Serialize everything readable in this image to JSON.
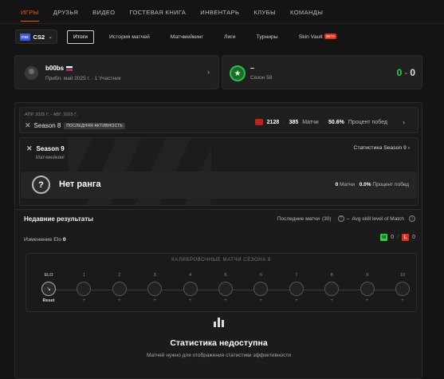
{
  "topnav": [
    {
      "label": "ИГРЫ",
      "active": true
    },
    {
      "label": "ДРУЗЬЯ"
    },
    {
      "label": "ВИДЕО"
    },
    {
      "label": "ГОСТЕВАЯ КНИГА"
    },
    {
      "label": "ИНВЕНТАРЬ"
    },
    {
      "label": "КЛУБЫ"
    },
    {
      "label": "КОМАНДЫ"
    }
  ],
  "game_selector": {
    "badge": "CS2",
    "name": "CS2"
  },
  "subtabs": [
    {
      "label": "Итоги",
      "active": true
    },
    {
      "label": "История матчей"
    },
    {
      "label": "Матчмейкинг"
    },
    {
      "label": "Лиги"
    },
    {
      "label": "Турниры"
    },
    {
      "label": "Skin Vault",
      "badge": "BETA"
    }
  ],
  "user": {
    "name": "b00bs",
    "meta": "Прибл. май 2025 г. · 1 Участник"
  },
  "season_card": {
    "dash": "–",
    "label": "Сезон 58",
    "wins": "0",
    "sep": "-",
    "losses": "0"
  },
  "season_row": {
    "dates": "АПР. 2025 Г. - АВГ. 2025 Г.",
    "name": "Season 8",
    "badge": "ПОСЛЕДНЯЯ АКТИВНОСТЬ",
    "elo": "2128",
    "matches": "385",
    "matches_label": "Матчи",
    "winrate": "50.6%",
    "winrate_label": "Процент побед"
  },
  "season9": {
    "title": "Season 9",
    "subtitle": "Матчмейкинг",
    "stats_link": "Статистика Season 9",
    "rank": "Нет ранга",
    "matches": "0",
    "matches_label": "Матчи",
    "winrate": "0.0%",
    "winrate_label": "Процент побед"
  },
  "recent": {
    "title": "Недавние результаты",
    "legend_prefix": "Последние матчи",
    "legend_count": "(30)",
    "legend_suffix": "Avg skill level of Match",
    "elo_change_label": "Изменение Elo",
    "elo_change_value": "0",
    "wins": "0",
    "losses": "0",
    "w_letter": "W",
    "l_letter": "L"
  },
  "calibration": {
    "title": "КАЛИБРОВОЧНЫЕ МАТЧИ СЕЗОНА 8",
    "first_label": "ELO",
    "first_bottom": "Reset",
    "nodes": [
      "1",
      "2",
      "3",
      "4",
      "5",
      "6",
      "7",
      "8",
      "9",
      "10"
    ],
    "node_bottom": "+"
  },
  "unavailable": {
    "title": "Статистика недоступна",
    "subtitle": "Матчей нужно для отображения статистики эффективности"
  }
}
